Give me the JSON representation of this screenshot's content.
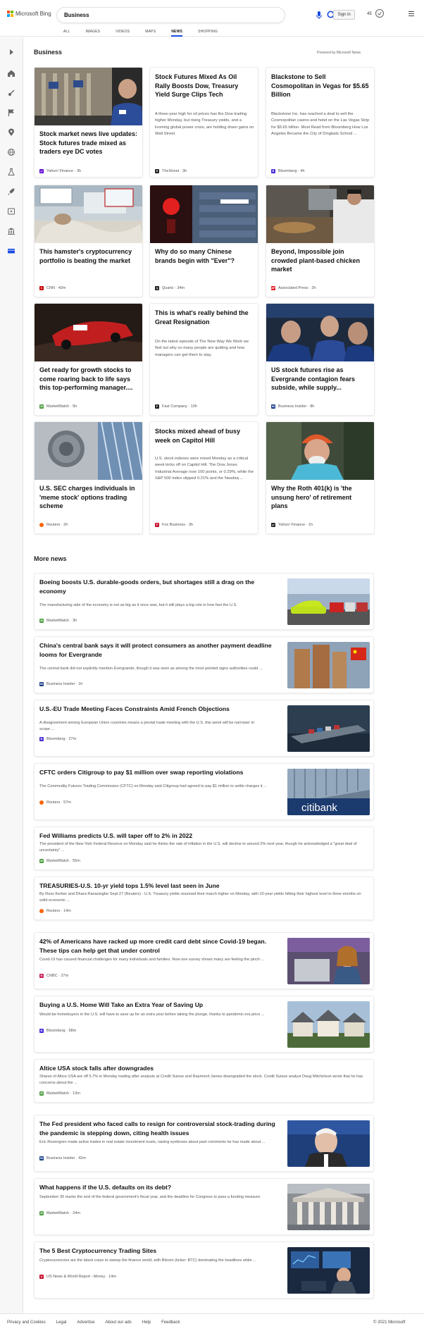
{
  "brand": {
    "name": "Microsoft Bing",
    "colors": [
      "#f25022",
      "#7fba00",
      "#00a4ef",
      "#ffb900"
    ]
  },
  "search": {
    "query": "Business"
  },
  "header": {
    "signin": "Sign in",
    "rewards_points": "45"
  },
  "tabs": [
    "ALL",
    "IMAGES",
    "VIDEOS",
    "MAPS",
    "NEWS",
    "SHOPPING"
  ],
  "active_tab": "NEWS",
  "section": {
    "title": "Business",
    "powered": "Powered by Microsoft News"
  },
  "cards": [
    {
      "title": "Stock market news live updates: Stock futures trade mixed as traders eye DC votes",
      "snippet": "",
      "source": "Yahoo! Finance",
      "time": "3h",
      "logo": "yahoo-icon",
      "logo_color": "#6001d2"
    },
    {
      "title": "Stock Futures Mixed As Oil Rally Boosts Dow, Treasury Yield Surge Clips Tech",
      "snippet": "A three-year high for oil prices has the Dow trading higher Monday, but rising Treasury yields, and a looming global power crisis, are holding down gains on Wall Street.",
      "source": "TheStreet",
      "time": "3h",
      "logo": "thestreet-icon",
      "logo_color": "#222222"
    },
    {
      "title": "Blackstone to Sell Cosmopolitan in Vegas for $5.65 Billion",
      "snippet": "Blackstone Inc. has reached a deal to sell the Cosmopolitan casino and hotel on the Las Vegas Strip for $5.65 billion. Most Read from Bloomberg How Los Angeles Became the City of Dingbats School ...",
      "source": "Bloomberg",
      "time": "4h",
      "logo": "bloomberg-icon",
      "logo_color": "#472ad6"
    },
    {
      "title": "This hamster's cryptocurrency portfolio is beating the market",
      "snippet": "",
      "source": "CNN",
      "time": "42m",
      "logo": "cnn-icon",
      "logo_color": "#cc0000"
    },
    {
      "title": "Why do so many Chinese brands begin with \"Ever\"?",
      "snippet": "",
      "source": "Quartz",
      "time": "34m",
      "logo": "quartz-icon",
      "logo_color": "#1a1a1a"
    },
    {
      "title": "Beyond, Impossible join crowded plant-based chicken market",
      "snippet": "",
      "source": "Associated Press",
      "time": "2h",
      "logo": "ap-icon",
      "logo_color": "#e31b23"
    },
    {
      "title": "Get ready for growth stocks to come roaring back to life says this top-performing manager....",
      "snippet": "",
      "source": "MarketWatch",
      "time": "5h",
      "logo": "marketwatch-icon",
      "logo_color": "#4e9d40"
    },
    {
      "title": "This is what's really behind the Great Resignation",
      "snippet": "On the latest episode of The New Way We Work we find out why so many people are quitting and how managers can get them to stay.",
      "source": "Fast Company",
      "time": "10h",
      "logo": "fastcompany-icon",
      "logo_color": "#222222"
    },
    {
      "title": "US stock futures rise as Evergrande contagion fears subside, while supply...",
      "snippet": "",
      "source": "Business Insider",
      "time": "8h",
      "logo": "businessinsider-icon",
      "logo_color": "#1b3f8b"
    },
    {
      "title": "U.S. SEC charges individuals in 'meme stock' options trading scheme",
      "snippet": "",
      "source": "Reuters",
      "time": "2h",
      "logo": "reuters-icon",
      "logo_color": "#fa6400"
    },
    {
      "title": "Stocks mixed ahead of busy week on Capitol Hill",
      "snippet": "U.S. stock indexes were mixed Monday as a critical week kicks off on Capitol Hill. The Dow Jones Industrial Average rose 100 points, or 0.29%, while the S&P 500 index slipped 0.21% and the Nasdaq ...",
      "source": "Fox Business",
      "time": "3h",
      "logo": "foxbusiness-icon",
      "logo_color": "#c8102e"
    },
    {
      "title": "Why the Roth 401(k) is 'the unsung hero' of retirement plans",
      "snippet": "",
      "source": "Yahoo! Finance",
      "time": "1h",
      "logo": "yahoo-icon",
      "logo_color": "#222222"
    }
  ],
  "more_news": {
    "title": "More news",
    "items": [
      {
        "title": "Boeing boosts U.S. durable-goods orders, but shortages still a drag on the economy",
        "snippet": "The manufacturing side of the economy is not as big as it once was, but it still plays a big role in how fast the U.S.",
        "source": "MarketWatch",
        "time": "3h",
        "logo": "marketwatch-icon",
        "logo_color": "#4e9d40"
      },
      {
        "title": "China's central bank says it will protect consumers as another payment deadline looms for Evergrande",
        "snippet": "The central bank did not explicitly mention Evergrande, though it was seen as among the most pointed signs authorities could ...",
        "source": "Business Insider",
        "time": "1h",
        "logo": "businessinsider-icon",
        "logo_color": "#1b3f8b"
      },
      {
        "title": "U.S.-EU Trade Meeting Faces Constraints Amid French Objections",
        "snippet": "A disagreement among European Union countries means a pivotal trade meeting with the U.S. this week will be narrower in scope ...",
        "source": "Bloomberg",
        "time": "27m",
        "logo": "bloomberg-icon",
        "logo_color": "#472ad6"
      },
      {
        "title": "CFTC orders Citigroup to pay $1 million over swap reporting violations",
        "snippet": "The Commodity Futures Trading Commission (CFTC) on Monday said Citigroup had agreed to pay $1 million to settle charges it ...",
        "source": "Reuters",
        "time": "57m",
        "logo": "reuters-icon",
        "logo_color": "#fa6400",
        "image_text": "citibank"
      },
      {
        "title": "Fed Williams predicts U.S. will taper off to 2% in 2022",
        "snippet": "The president of the New York Federal Reserve on Monday said he thinks the rate of inflation in the U.S. will decline to around 2% next year, though he acknowledged a \"great deal of uncertainty\" ...",
        "source": "MarketWatch",
        "time": "55m",
        "logo": "marketwatch-icon",
        "logo_color": "#4e9d40"
      },
      {
        "title": "TREASURIES-U.S. 10-yr yield tops 1.5% level last seen in June",
        "snippet": "By Ross Kerber and Dhara Ranasinghe Sept 27 (Reuters) - U.S. Treasury yields resumed their march higher on Monday, with 10-year yields hitting their highest level in three months on solid economic ...",
        "source": "Reuters",
        "time": "14m",
        "logo": "reuters-icon",
        "logo_color": "#fa6400"
      },
      {
        "title": "42% of Americans have racked up more credit card debt since Covid-19 began. These tips can help get that under control",
        "snippet": "Covid-19 has caused financial challenges for many individuals and families. Now one survey shows many are feeling the pinch ...",
        "source": "CNBC",
        "time": "27m",
        "logo": "cnbc-icon",
        "logo_color": "#c81d5d"
      },
      {
        "title": "Buying a U.S. Home Will Take an Extra Year of Saving Up",
        "snippet": "Would-be homebuyers in the U.S. will have to save up for an extra year before taking the plunge, thanks to pandemic-era price ...",
        "source": "Bloomberg",
        "time": "58m",
        "logo": "bloomberg-icon",
        "logo_color": "#472ad6"
      },
      {
        "title": "Altice USA stock falls after downgrades",
        "snippet": "Shares of Altice USA are off 5.7% in Monday trading after analysts at Credit Suisse and Raymond James downgraded the stock. Credit Suisse analyst Doug Mitchelson wrote that he has concerns about the ...",
        "source": "MarketWatch",
        "time": "13m",
        "logo": "marketwatch-icon",
        "logo_color": "#4e9d40"
      },
      {
        "title": "The Fed president who faced calls to resign for controversial stock-trading during the pandemic is stepping down, citing health issues",
        "snippet": "Eric Rosengren made active trades in real estate investment trusts, raising eyebrows about past comments he has made about ...",
        "source": "Business Insider",
        "time": "42m",
        "logo": "businessinsider-icon",
        "logo_color": "#1b3f8b"
      },
      {
        "title": "What happens if the U.S. defaults on its debt?",
        "snippet": "September 30 marks the end of the federal government's fiscal year, and the deadline for Congress to pass a funding measure.",
        "source": "MarketWatch",
        "time": "24m",
        "logo": "marketwatch-icon",
        "logo_color": "#4e9d40"
      },
      {
        "title": "The 5 Best Cryptocurrency Trading Sites",
        "snippet": "Cryptocurrencies are the latest craze to sweep the finance world, with Bitcoin (ticker: BTC) dominating the headlines while ...",
        "source": "US News & World Report - Money",
        "time": "14m",
        "logo": "usnews-icon",
        "logo_color": "#c8102e"
      }
    ]
  },
  "footer": {
    "links": [
      "Privacy and Cookies",
      "Legal",
      "Advertise",
      "About our ads",
      "Help",
      "Feedback"
    ],
    "copyright": "© 2021 Microsoft"
  },
  "rail_icons": [
    "expand-icon",
    "home-icon",
    "sports-icon",
    "flag-icon",
    "location-icon",
    "globe-icon",
    "science-icon",
    "rocket-icon",
    "entertainment-icon",
    "politics-icon",
    "money-icon"
  ],
  "accent": "#174ae4"
}
